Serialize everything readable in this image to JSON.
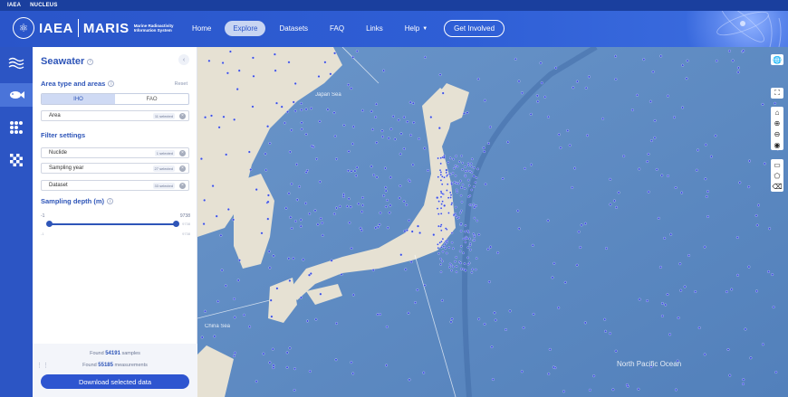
{
  "topstrip": {
    "links": [
      "IAEA",
      "NUCLEUS"
    ]
  },
  "header": {
    "logo_iaea": "IAEA",
    "logo_maris": "MARIS",
    "logo_subtitle": "Marine Radioactivity Information System",
    "nav": {
      "home": "Home",
      "explore": "Explore",
      "datasets": "Datasets",
      "faq": "FAQ",
      "links": "Links",
      "help": "Help",
      "get_involved": "Get Involved"
    }
  },
  "sidebar": {
    "icons": [
      "waves-icon",
      "fish-icon",
      "dots-icon",
      "checker-icon"
    ],
    "active_index": 1
  },
  "panel": {
    "title": "Seawater",
    "area_section": "Area type and areas",
    "reset": "Reset",
    "area_types": [
      "IHO",
      "FAO"
    ],
    "area_type_selected": "IHO",
    "area_field": {
      "label": "Area",
      "badge": "11 selected"
    },
    "filter_section": "Filter settings",
    "filters": [
      {
        "label": "Nuclide",
        "badge": "1 selected"
      },
      {
        "label": "Sampling year",
        "badge": "27 selected"
      },
      {
        "label": "Dataset",
        "badge": "33 selected"
      }
    ],
    "depth_section": "Sampling depth (m)",
    "depth": {
      "min": "-1",
      "max": "9738",
      "sub_min": "-1",
      "sub_max": "9738",
      "sub_max2": "9738"
    },
    "found_samples_prefix": "Found",
    "found_samples_value": "54191",
    "found_samples_suffix": "samples",
    "found_meas_prefix": "Found",
    "found_meas_value": "55185",
    "found_meas_suffix": "measurements",
    "download": "Download selected data"
  },
  "map": {
    "labels": {
      "pacific": "North Pacific Ocean",
      "japan_sea": "Japan Sea",
      "china_sea": "China Sea"
    },
    "land_color": "#e8e2d4",
    "ocean_color": "#5c88c0",
    "dot_color": "#3d4fe0"
  }
}
